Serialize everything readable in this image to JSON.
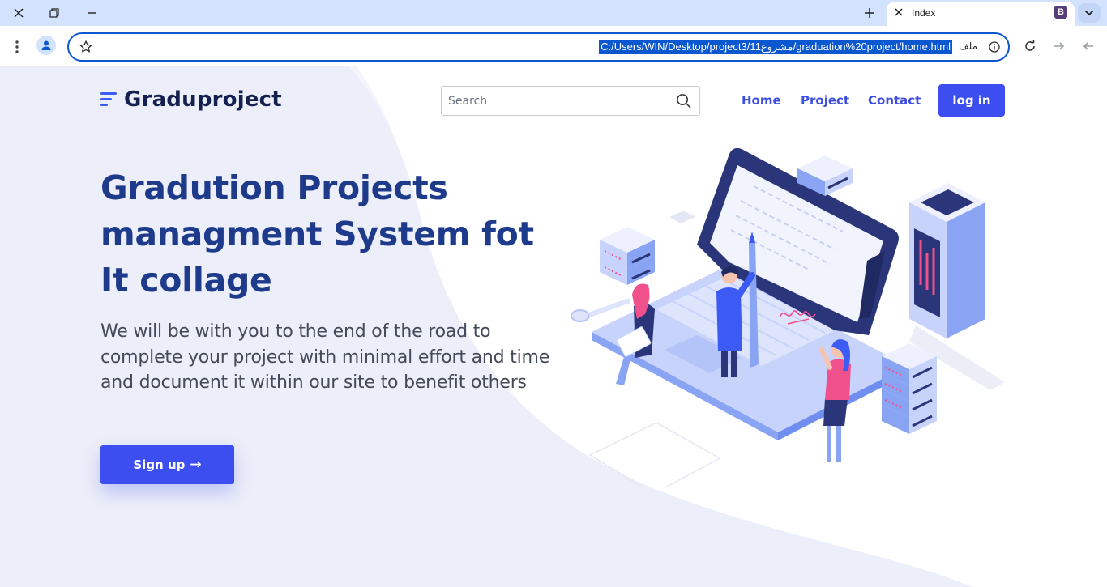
{
  "browser": {
    "tab_title": "Index",
    "tab_favicon_letter": "B",
    "url": "C:/Users/WIN/Desktop/project3/11مشروع/graduation%20project/home.html",
    "file_label": "ملف",
    "colors": {
      "titlebar": "#d3e3fd",
      "omnibox_border": "#0b57d0"
    }
  },
  "nav": {
    "brand": "Graduproject",
    "search_placeholder": "Search",
    "links": [
      "Home",
      "Project",
      "Contact"
    ],
    "login": "log in"
  },
  "hero": {
    "title_lines": [
      "Gradution Projects",
      "managment System fot",
      "It collage"
    ],
    "description": "We will be with you to the end of the road to complete your project with minimal effort and time and document it within our site to benefit others",
    "signup": "Sign up",
    "signup_arrow": "→"
  },
  "theme": {
    "primary": "#3d4ef0",
    "heading": "#1e3a8a",
    "accent_pink": "#f0508c"
  }
}
